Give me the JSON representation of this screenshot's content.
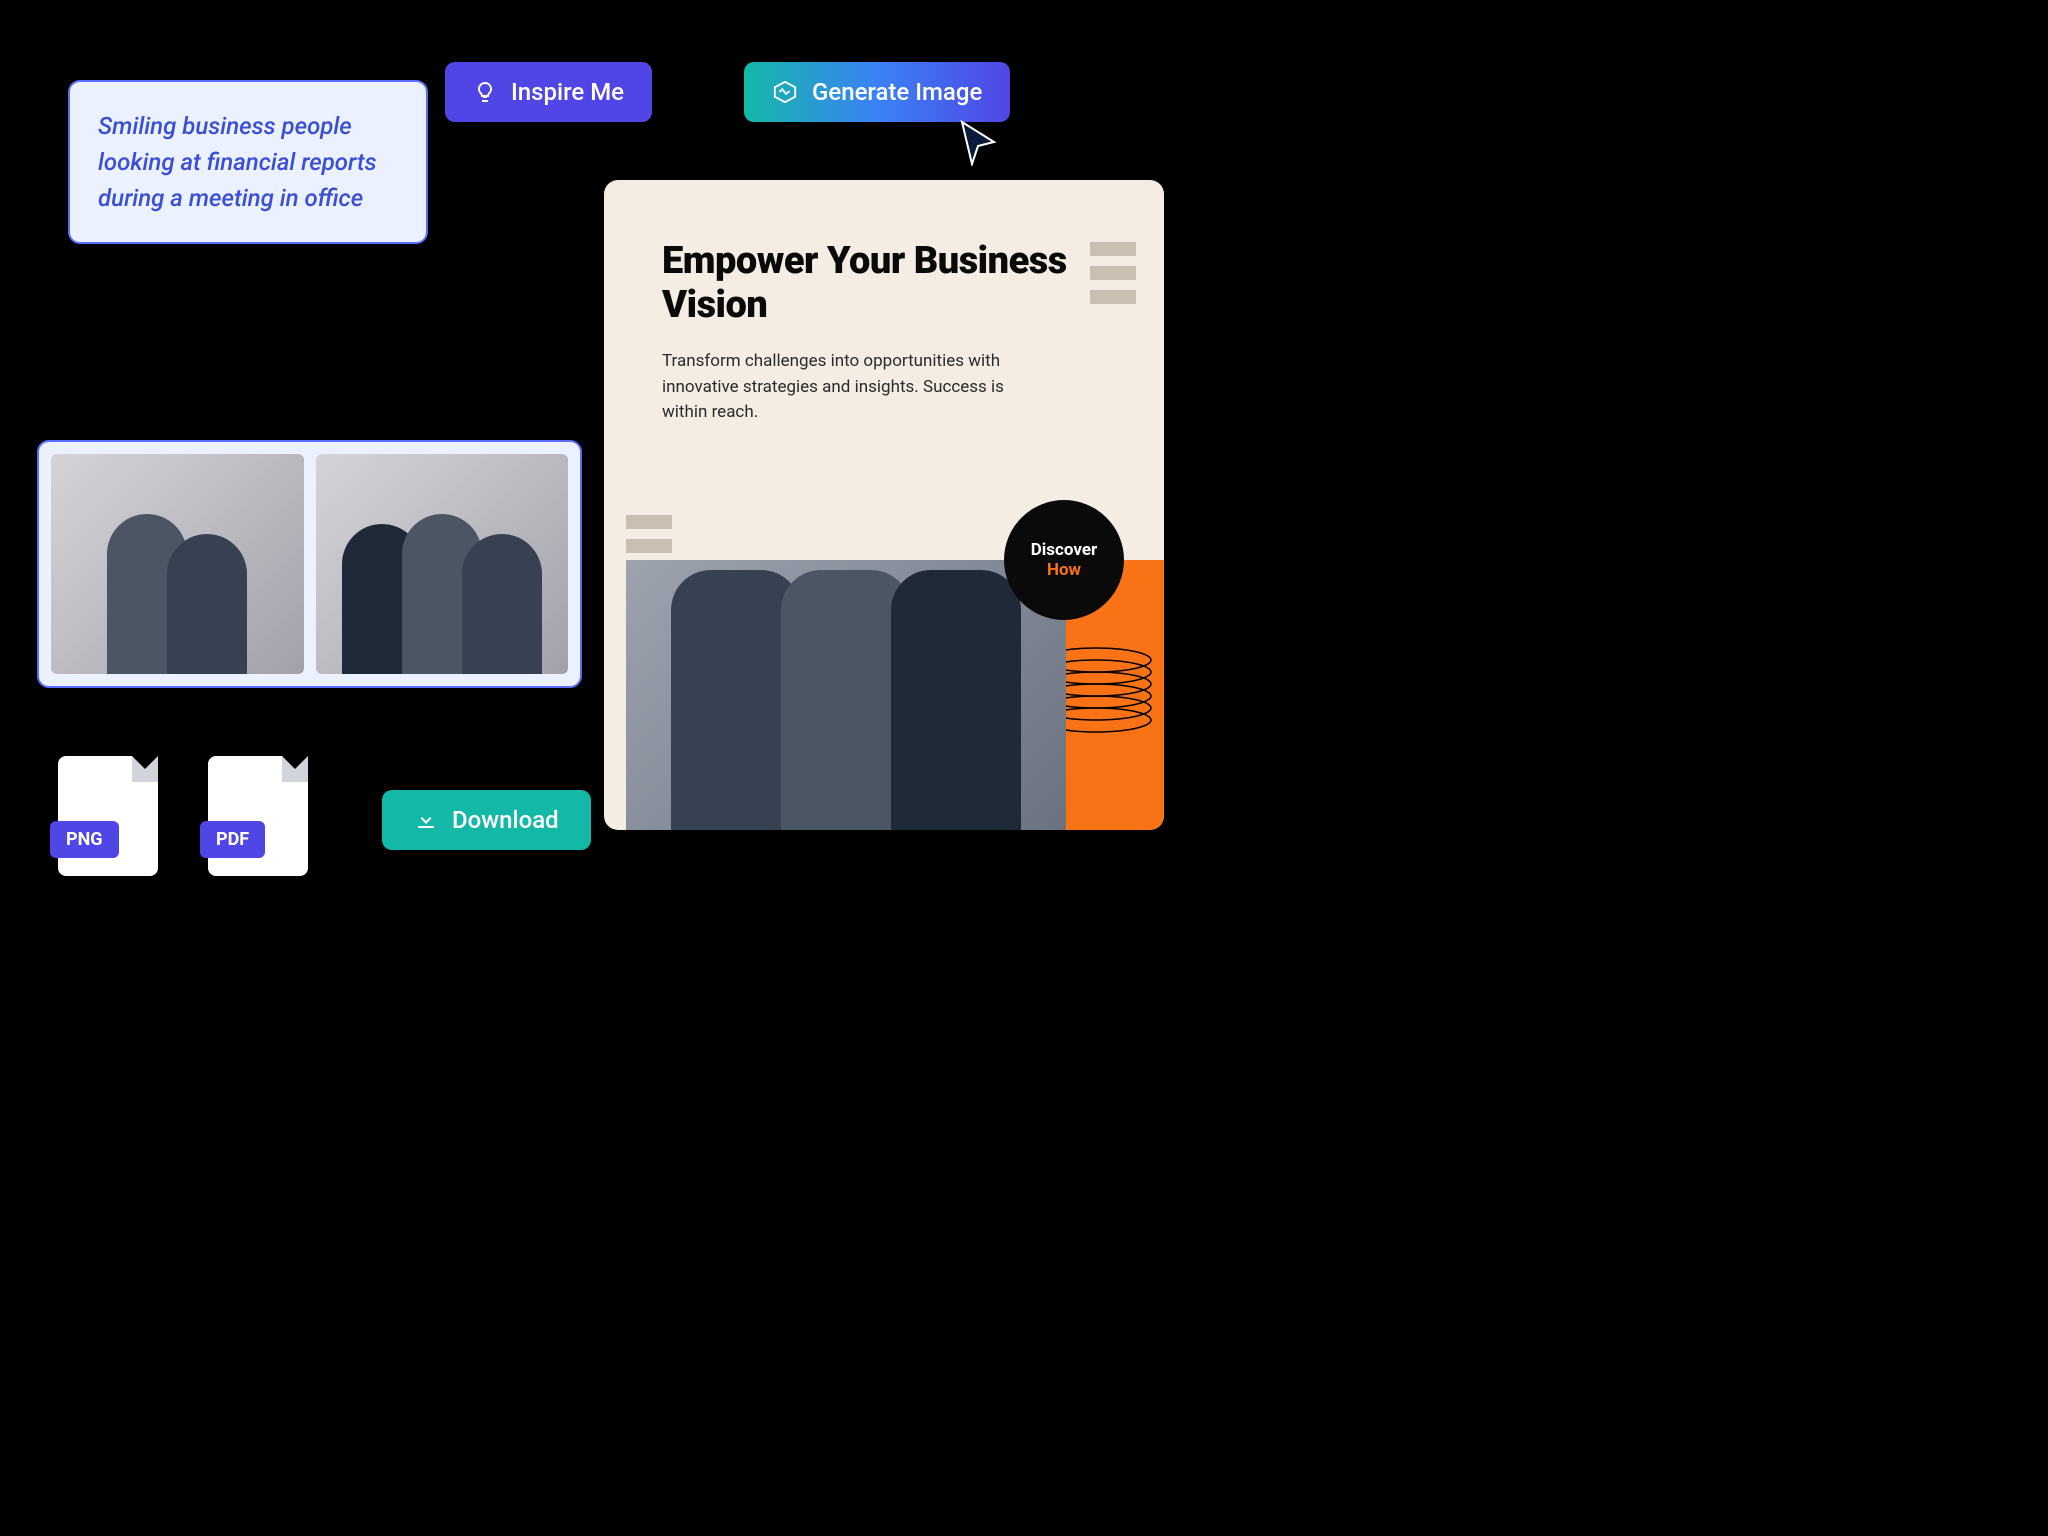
{
  "prompt": {
    "text": "Smiling business people looking at financial reports during a meeting in office"
  },
  "buttons": {
    "inspire": "Inspire Me",
    "generate": "Generate Image",
    "download": "Download"
  },
  "poster": {
    "title": "Empower Your Business Vision",
    "body": "Transform challenges into opportunities with innovative strategies and insights. Success is within reach.",
    "cta_top": "Discover",
    "cta_bottom": "How"
  },
  "files": {
    "png": "PNG",
    "pdf": "PDF"
  }
}
